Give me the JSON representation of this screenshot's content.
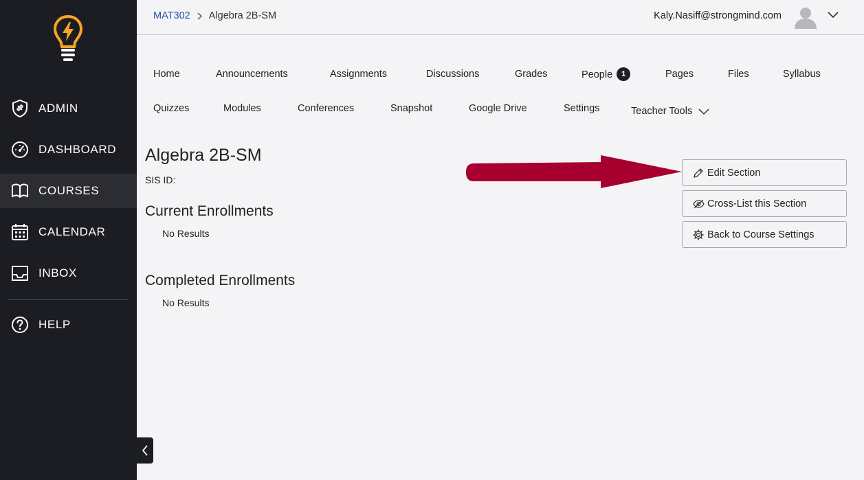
{
  "sidebar": {
    "items": [
      {
        "label": "ADMIN",
        "icon": "shield-icon"
      },
      {
        "label": "DASHBOARD",
        "icon": "gauge-icon"
      },
      {
        "label": "COURSES",
        "icon": "book-icon",
        "active": true
      },
      {
        "label": "CALENDAR",
        "icon": "calendar-icon"
      },
      {
        "label": "INBOX",
        "icon": "inbox-icon"
      },
      {
        "label": "HELP",
        "icon": "help-icon"
      }
    ]
  },
  "breadcrumb": {
    "course": "MAT302",
    "current": "Algebra 2B-SM"
  },
  "user": {
    "email": "Kaly.Nasiff@strongmind.com"
  },
  "tabs": {
    "row1": [
      "Home",
      "Announcements",
      "Assignments",
      "Discussions",
      "Grades",
      "People",
      "Pages",
      "Files",
      "Syllabus"
    ],
    "row2": [
      "Quizzes",
      "Modules",
      "Conferences",
      "Snapshot",
      "Google Drive",
      "Settings",
      "Teacher Tools"
    ],
    "people_badge": "1"
  },
  "main": {
    "title": "Algebra 2B-SM",
    "sis_label": "SIS ID:",
    "current_heading": "Current Enrollments",
    "current_empty": "No Results",
    "completed_heading": "Completed Enrollments",
    "completed_empty": "No Results"
  },
  "actions": {
    "edit": "Edit Section",
    "crosslist": "Cross-List this Section",
    "back": "Back to Course Settings"
  },
  "colors": {
    "sidebar_bg": "#1c1d23",
    "accent_link": "#2a4fa8",
    "arrow": "#a8002e",
    "logo": "#f5a623"
  }
}
